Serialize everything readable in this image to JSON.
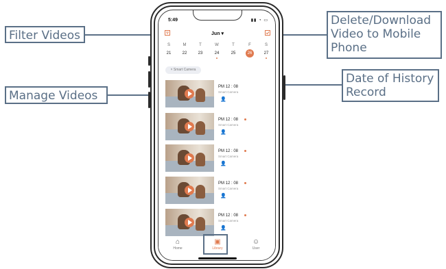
{
  "callouts": {
    "filter_videos": "Filter Videos",
    "manage_videos": "Manage Videos",
    "delete_download_line1": "Delete/Download",
    "delete_download_line2": "Video to Mobile",
    "delete_download_line3": "Phone",
    "history_line1": "Date of History",
    "history_line2": "Record"
  },
  "colors": {
    "accent": "#e07a4f",
    "callout": "#5a6f86"
  },
  "status": {
    "time": "5:49",
    "icons": "signal wifi battery"
  },
  "header": {
    "month": "Jun",
    "filter_icon": "filter-icon",
    "edit_icon": "select-icon"
  },
  "calendar": {
    "weekdays": [
      "S",
      "M",
      "T",
      "W",
      "T",
      "F",
      "S"
    ],
    "days": [
      "21",
      "22",
      "23",
      "24",
      "25",
      "26",
      "27"
    ]
  },
  "filter_chip": "× Smart Camera",
  "videos": [
    {
      "time": "PM 12 :  08",
      "camera": "Smart Camera"
    },
    {
      "time": "PM 12 :  08",
      "camera": "Smart Camera"
    },
    {
      "time": "PM 12 :  08",
      "camera": "Smart Camera"
    },
    {
      "time": "PM 12 :  08",
      "camera": "Smart Camera"
    },
    {
      "time": "PM 12 :  08",
      "camera": "Smart Camera"
    }
  ],
  "tabs": [
    {
      "label": "Home",
      "icon": "home-icon"
    },
    {
      "label": "Library",
      "icon": "library-icon"
    },
    {
      "label": "User",
      "icon": "user-icon"
    }
  ]
}
